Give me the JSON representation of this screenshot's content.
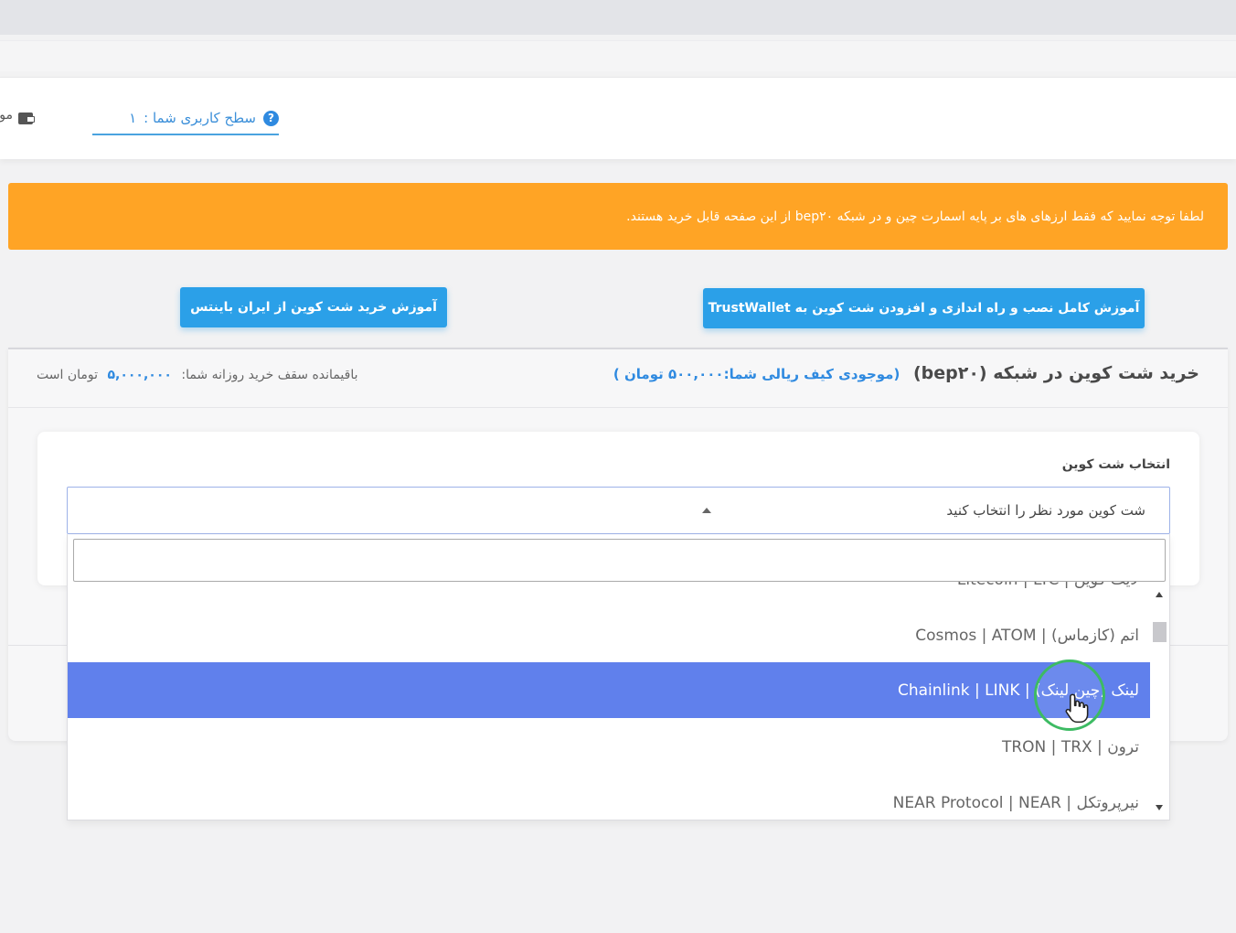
{
  "header": {
    "user_level_label": "سطح کاربری شما :",
    "user_level_value": "۱",
    "help_icon": "?",
    "wallet_label": "موجودی"
  },
  "alert": {
    "text": "لطفا توجه نمایید که فقط ارزهای های بر پایه اسمارت چین و در شبکه bep۲۰ از این صفحه قابل خرید هستند."
  },
  "buttons": {
    "trustwallet_tutorial": "آموزش کامل نصب و راه اندازی و افزودن شت کوین به TrustWallet",
    "binance_tutorial": "آموزش خرید شت کوین از ایران باینتس"
  },
  "panel": {
    "title": "خرید شت کوین در شبکه (bep۲۰)",
    "wallet_balance": "(موجودی کیف ریالی شما:۵۰۰,۰۰۰ تومان )",
    "daily_limit_label": "باقیمانده سقف خرید روزانه شما:",
    "daily_limit_amount": "۵,۰۰۰,۰۰۰",
    "daily_limit_unit": "تومان است"
  },
  "form": {
    "select_label": "انتخاب شت کوین",
    "select_placeholder": "شت کوین مورد نظر را انتخاب کنید",
    "search_value": ""
  },
  "options": [
    {
      "label": "لایت کوین | Litecoin | LTC",
      "selected": false
    },
    {
      "label": "اتم (کازماس) | Cosmos | ATOM",
      "selected": false
    },
    {
      "label": "لینک (چین لینک) | Chainlink | LINK",
      "selected": true
    },
    {
      "label": "ترون | TRON | TRX",
      "selected": false
    },
    {
      "label": "نیرپروتکل | NEAR Protocol | NEAR",
      "selected": false
    }
  ],
  "colors": {
    "alert_bg": "#ffa425",
    "button_bg": "#2ba0e8",
    "selected_option_bg": "#6080ec",
    "link_blue": "#2f8ae0",
    "cursor_ring": "#3dbb63"
  }
}
